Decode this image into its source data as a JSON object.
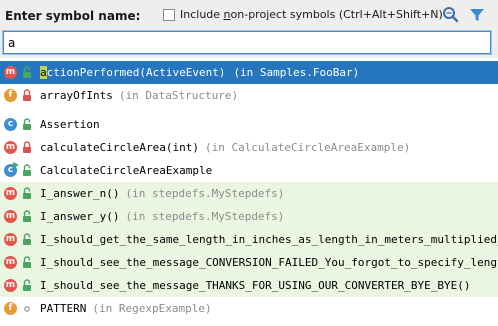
{
  "header": {
    "title": "Enter symbol name:",
    "nonproject_prefix": "Include ",
    "nonproject_mnemonic": "n",
    "nonproject_suffix": "on-project symbols (Ctrl+Alt+Shift+N)",
    "nonproject_checked": false
  },
  "search": {
    "value": "a",
    "placeholder": ""
  },
  "colors": {
    "selection": "#2675bf",
    "green_row": "#eaf5e2",
    "method_icon": "#e2564b",
    "field_icon": "#e49a35",
    "class_icon": "#3d8fd0",
    "lock": "#d9534f",
    "unlock": "#4aa563",
    "highlight": "#c4d34a",
    "location_text": "#8c8c8c"
  },
  "results": [
    {
      "icon": "m",
      "icon_name": "method-icon",
      "modifier": "unlock",
      "match": "a",
      "rest": "ctionPerformed(ActiveEvent)",
      "location": "(in Samples.FooBar)",
      "selected": true
    },
    {
      "icon": "f",
      "icon_name": "field-icon",
      "modifier": "lock",
      "match": "",
      "rest": "arrayOfInts",
      "location": "(in DataStructure)"
    },
    {
      "icon": "c",
      "icon_name": "class-icon",
      "modifier": "unlock",
      "match": "",
      "rest": "Assertion",
      "location": "",
      "sep": true
    },
    {
      "icon": "m",
      "icon_name": "method-icon",
      "modifier": "lock",
      "match": "",
      "rest": "calculateCircleArea(int)",
      "location": "(in CalculateCircleAreaExample)"
    },
    {
      "icon": "c",
      "icon_name": "runnable-class-icon",
      "modifier": "unlock",
      "match": "",
      "rest": "CalculateCircleAreaExample",
      "location": ""
    },
    {
      "icon": "m",
      "icon_name": "method-icon",
      "modifier": "unlock",
      "match": "",
      "rest": "I_answer_n()",
      "location": "(in stepdefs.MyStepdefs)",
      "green": true
    },
    {
      "icon": "m",
      "icon_name": "method-icon",
      "modifier": "unlock",
      "match": "",
      "rest": "I_answer_y()",
      "location": "(in stepdefs.MyStepdefs)",
      "green": true
    },
    {
      "icon": "m",
      "icon_name": "method-icon",
      "modifier": "unlock",
      "match": "",
      "rest": "I_should_get_the_same_length_in_inches_as_length_in_meters_multiplied_by()",
      "location": "",
      "green": true
    },
    {
      "icon": "m",
      "icon_name": "method-icon",
      "modifier": "unlock",
      "match": "",
      "rest": "I_should_see_the_message_CONVERSION_FAILED_You_forgot_to_specify_length()",
      "location": "",
      "green": true
    },
    {
      "icon": "m",
      "icon_name": "method-icon",
      "modifier": "unlock",
      "match": "",
      "rest": "I_should_see_the_message_THANKS_FOR_USING_OUR_CONVERTER_BYE_BYE()",
      "location": "",
      "green": true
    },
    {
      "icon": "f",
      "icon_name": "field-icon",
      "modifier": "dot",
      "match": "",
      "rest": "PATTERN",
      "location": "(in RegexpExample)"
    }
  ]
}
